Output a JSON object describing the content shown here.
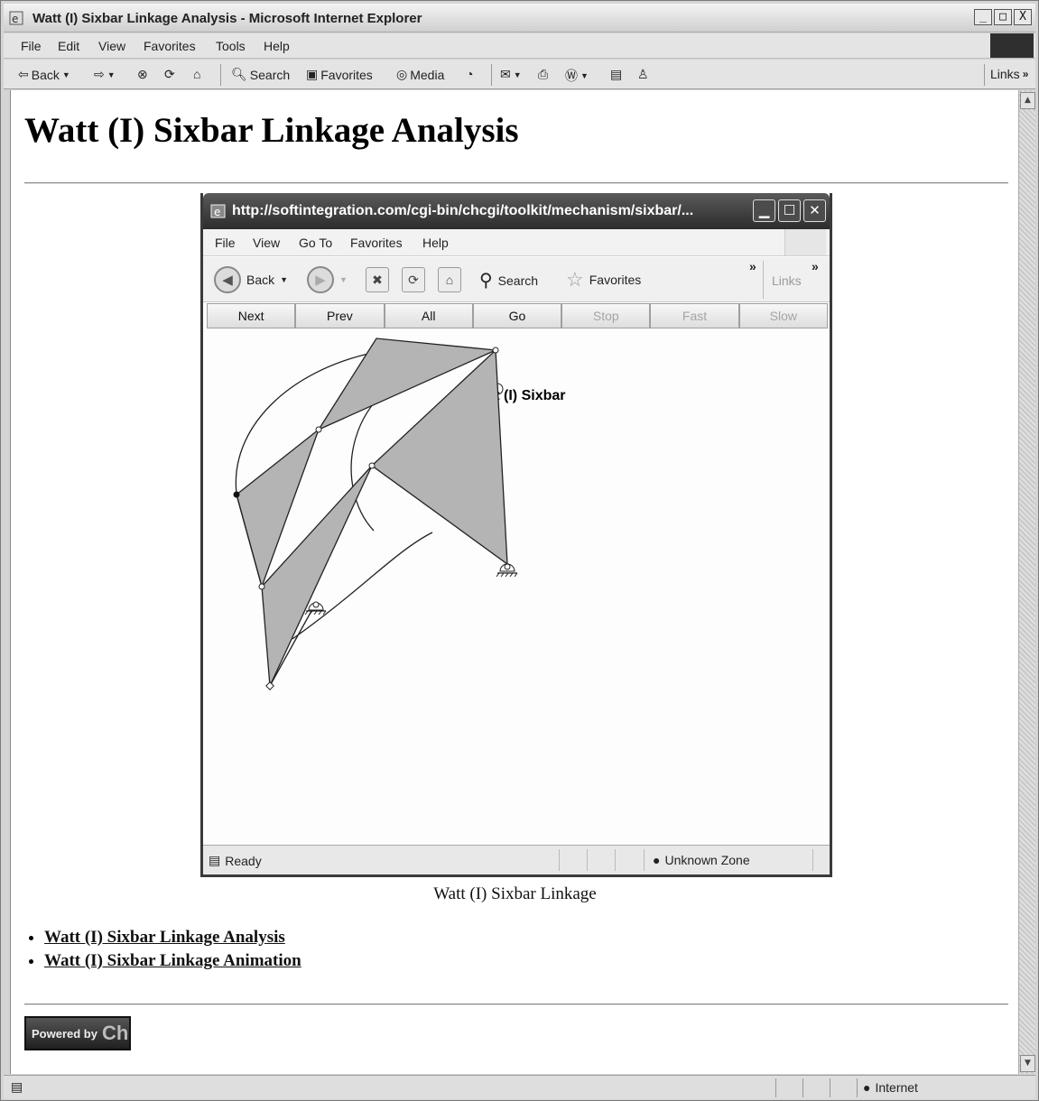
{
  "window": {
    "title": "Watt (I) Sixbar Linkage Analysis - Microsoft Internet Explorer",
    "controls": [
      "_",
      "□",
      "X"
    ]
  },
  "menu": [
    "File",
    "Edit",
    "View",
    "Favorites",
    "Tools",
    "Help"
  ],
  "toolbar": {
    "back": "Back",
    "search": "Search",
    "favorites": "Favorites",
    "media": "Media",
    "links": "Links"
  },
  "page": {
    "title": "Watt (I) Sixbar Linkage Analysis",
    "caption": "Watt (I) Sixbar Linkage",
    "links": [
      "Watt (I) Sixbar Linkage Analysis",
      "Watt (I) Sixbar Linkage Animation"
    ],
    "powered_by": "Powered by",
    "powered_logo": "Ch"
  },
  "inner_window": {
    "title": "http://softintegration.com/cgi-bin/chcgi/toolkit/mechanism/sixbar/...",
    "menu": [
      "File",
      "View",
      "Go To",
      "Favorites",
      "Help"
    ],
    "toolbar": {
      "back": "Back",
      "search": "Search",
      "favorites": "Favorites",
      "links": "Links"
    },
    "buttons": [
      {
        "label": "Next",
        "enabled": true
      },
      {
        "label": "Prev",
        "enabled": true
      },
      {
        "label": "All",
        "enabled": true
      },
      {
        "label": "Go",
        "enabled": true
      },
      {
        "label": "Stop",
        "enabled": false
      },
      {
        "label": "Fast",
        "enabled": false
      },
      {
        "label": "Slow",
        "enabled": false
      }
    ],
    "plot_title": "Watt (I) Sixbar",
    "status": "Ready",
    "zone": "Unknown Zone"
  },
  "statusbar": {
    "zone": "Internet"
  },
  "colors": {
    "link_fill": "#b4b4b4",
    "link_stroke": "#222222",
    "title_bar_dark": "#2c2c2c"
  }
}
